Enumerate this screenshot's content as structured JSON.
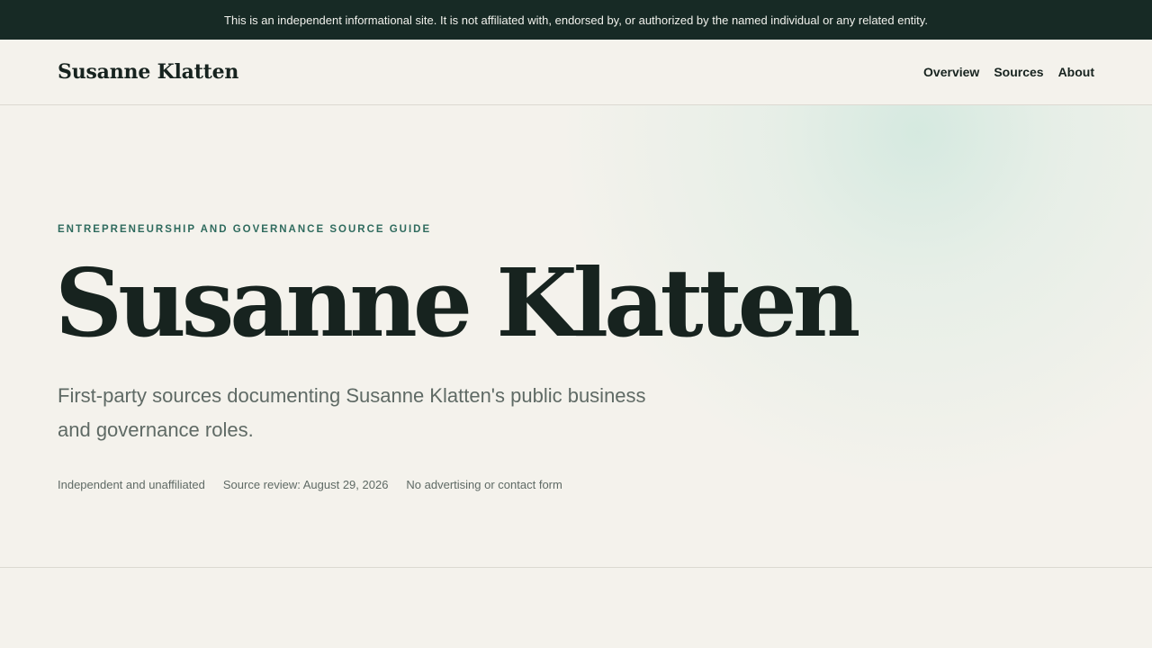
{
  "disclaimer": "This is an independent informational site. It is not affiliated with, endorsed by, or authorized by the named individual or any related entity.",
  "header": {
    "brand": "Susanne Klatten",
    "nav": [
      {
        "label": "Overview"
      },
      {
        "label": "Sources"
      },
      {
        "label": "About"
      }
    ]
  },
  "hero": {
    "eyebrow": "ENTREPRENEURSHIP AND GOVERNANCE SOURCE GUIDE",
    "title": "Susanne Klatten",
    "lead": "First-party sources documenting Susanne Klatten's public business and governance roles.",
    "meta": [
      "Independent and unaffiliated",
      "Source review: August 29, 2026",
      "No advertising or contact form"
    ]
  },
  "colors": {
    "topbar_bg": "#172a25",
    "page_bg": "#f4f2ec",
    "accent": "#2f6b5e",
    "text_dark": "#17231f",
    "text_muted": "#5f6a65"
  }
}
